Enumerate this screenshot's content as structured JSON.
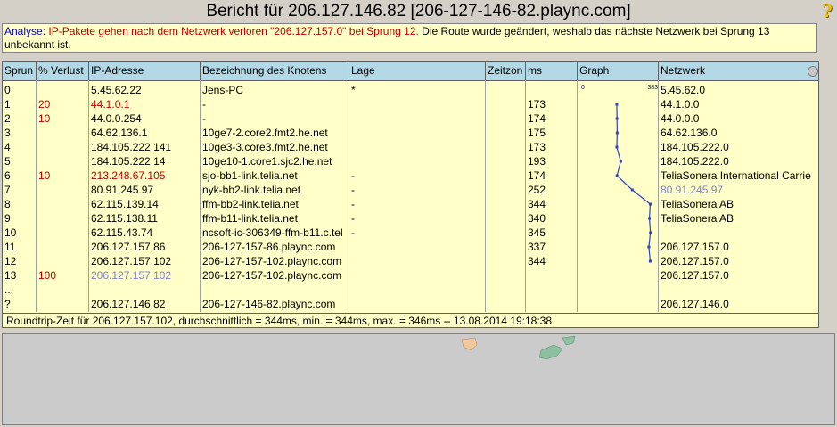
{
  "title": "Bericht für 206.127.146.82 [206-127-146-82.plaync.com]",
  "analysis": {
    "label": "Analyse:",
    "warning": "IP-Pakete gehen nach dem Netzwerk verloren \"206.127.157.0\" bei Sprung 12.",
    "note": "Die Route wurde geändert, weshalb das nächste Netzwerk bei Sprung 13 unbekannt ist."
  },
  "columns": [
    "Sprun",
    "% Verlust",
    "IP-Adresse",
    "Bezeichnung des Knotens",
    "Lage",
    "Zeitzon",
    "ms",
    "Graph",
    "Netzwerk"
  ],
  "graph_scale": {
    "min": "0",
    "max": "383"
  },
  "hops": [
    {
      "hop": "0",
      "loss": "",
      "ip": "5.45.62.22",
      "name": "Jens-PC",
      "loc": "*",
      "tz": "",
      "ms": "",
      "net": "5.45.62.0",
      "ip_style": "",
      "net_style": ""
    },
    {
      "hop": "1",
      "loss": "20",
      "ip": "44.1.0.1",
      "name": "-",
      "loc": "",
      "tz": "",
      "ms": "173",
      "net": "44.1.0.0",
      "ip_style": "red",
      "net_style": ""
    },
    {
      "hop": "2",
      "loss": "10",
      "ip": "44.0.0.254",
      "name": "-",
      "loc": "",
      "tz": "",
      "ms": "174",
      "net": "44.0.0.0",
      "ip_style": "",
      "net_style": ""
    },
    {
      "hop": "3",
      "loss": "",
      "ip": "64.62.136.1",
      "name": "10ge7-2.core2.fmt2.he.net",
      "loc": "",
      "tz": "",
      "ms": "175",
      "net": "64.62.136.0",
      "ip_style": "",
      "net_style": ""
    },
    {
      "hop": "4",
      "loss": "",
      "ip": "184.105.222.141",
      "name": "10ge3-3.core3.fmt2.he.net",
      "loc": "",
      "tz": "",
      "ms": "173",
      "net": "184.105.222.0",
      "ip_style": "",
      "net_style": ""
    },
    {
      "hop": "5",
      "loss": "",
      "ip": "184.105.222.14",
      "name": "10ge10-1.core1.sjc2.he.net",
      "loc": "",
      "tz": "",
      "ms": "193",
      "net": "184.105.222.0",
      "ip_style": "",
      "net_style": ""
    },
    {
      "hop": "6",
      "loss": "10",
      "ip": "213.248.67.105",
      "name": "sjo-bb1-link.telia.net",
      "loc": "-",
      "tz": "",
      "ms": "174",
      "net": "TeliaSonera International Carrie",
      "ip_style": "red",
      "net_style": ""
    },
    {
      "hop": "7",
      "loss": "",
      "ip": "80.91.245.97",
      "name": "nyk-bb2-link.telia.net",
      "loc": "-",
      "tz": "",
      "ms": "252",
      "net": "80.91.245.97",
      "ip_style": "",
      "net_style": "purple"
    },
    {
      "hop": "8",
      "loss": "",
      "ip": "62.115.139.14",
      "name": "ffm-bb2-link.telia.net",
      "loc": "-",
      "tz": "",
      "ms": "344",
      "net": "TeliaSonera AB",
      "ip_style": "",
      "net_style": ""
    },
    {
      "hop": "9",
      "loss": "",
      "ip": "62.115.138.11",
      "name": "ffm-b11-link.telia.net",
      "loc": "-",
      "tz": "",
      "ms": "340",
      "net": "TeliaSonera AB",
      "ip_style": "",
      "net_style": ""
    },
    {
      "hop": "10",
      "loss": "",
      "ip": "62.115.43.74",
      "name": "ncsoft-ic-306349-ffm-b11.c.tel",
      "loc": "-",
      "tz": "",
      "ms": "345",
      "net": "",
      "ip_style": "",
      "net_style": ""
    },
    {
      "hop": "11",
      "loss": "",
      "ip": "206.127.157.86",
      "name": "206-127-157-86.plaync.com",
      "loc": "",
      "tz": "",
      "ms": "337",
      "net": "206.127.157.0",
      "ip_style": "",
      "net_style": ""
    },
    {
      "hop": "12",
      "loss": "",
      "ip": "206.127.157.102",
      "name": "206-127-157-102.plaync.com",
      "loc": "",
      "tz": "",
      "ms": "344",
      "net": "206.127.157.0",
      "ip_style": "",
      "net_style": ""
    },
    {
      "hop": "13",
      "loss": "100",
      "ip": "206.127.157.102",
      "name": "206-127-157-102.plaync.com",
      "loc": "",
      "tz": "",
      "ms": "",
      "net": "206.127.157.0",
      "ip_style": "purple",
      "net_style": ""
    },
    {
      "hop": "...",
      "loss": "",
      "ip": "",
      "name": "",
      "loc": "",
      "tz": "",
      "ms": "",
      "net": "",
      "ip_style": "",
      "net_style": ""
    },
    {
      "hop": "?",
      "loss": "",
      "ip": "206.127.146.82",
      "name": "206-127-146-82.plaync.com",
      "loc": "",
      "tz": "",
      "ms": "",
      "net": "206.127.146.0",
      "ip_style": "",
      "net_style": ""
    }
  ],
  "footer": "Roundtrip-Zeit für 206.127.157.102, durchschnittlich = 344ms, min. = 344ms, max. = 346ms -- 13.08.2014 19:18:38",
  "colors": {
    "header_bg": "#b4d9e6",
    "table_bg": "#ffffc8",
    "loss_red": "#c00000",
    "unresolved_purple": "#8080c8",
    "graph_line": "#3040c0"
  }
}
